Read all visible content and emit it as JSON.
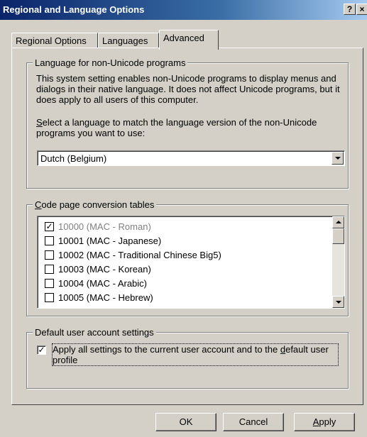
{
  "window": {
    "title": "Regional and Language Options",
    "help_label": "?",
    "close_label": "×"
  },
  "tabs": [
    {
      "label": "Regional Options"
    },
    {
      "label": "Languages"
    },
    {
      "label": "Advanced"
    }
  ],
  "non_unicode": {
    "legend": "Language for non-Unicode programs",
    "description": "This system setting enables non-Unicode programs to display menus and dialogs in their native language. It does not affect Unicode programs, but it does apply to all users of this computer.",
    "prompt_accel": "S",
    "prompt_rest": "elect a language to match the language version of the non-Unicode programs you want to use:",
    "selected_language": "Dutch (Belgium)"
  },
  "code_pages": {
    "legend_accel": "C",
    "legend_rest": "ode page conversion tables",
    "items": [
      {
        "label": "10000 (MAC - Roman)",
        "checked": true,
        "disabled": true
      },
      {
        "label": "10001 (MAC - Japanese)",
        "checked": false,
        "disabled": false
      },
      {
        "label": "10002 (MAC - Traditional Chinese Big5)",
        "checked": false,
        "disabled": false
      },
      {
        "label": "10003 (MAC - Korean)",
        "checked": false,
        "disabled": false
      },
      {
        "label": "10004 (MAC - Arabic)",
        "checked": false,
        "disabled": false
      },
      {
        "label": "10005 (MAC - Hebrew)",
        "checked": false,
        "disabled": false
      }
    ]
  },
  "default_user": {
    "legend": "Default user account settings",
    "label_part1": "Apply all settings to the current user account and to the ",
    "label_accel": "d",
    "label_part2": "efault user profile",
    "checked": true
  },
  "buttons": {
    "ok": "OK",
    "cancel": "Cancel",
    "apply_accel": "A",
    "apply_rest": "pply"
  },
  "colors": {
    "titlebar_start": "#0a246a",
    "titlebar_end": "#a6caf0",
    "face": "#d4d0c8"
  }
}
